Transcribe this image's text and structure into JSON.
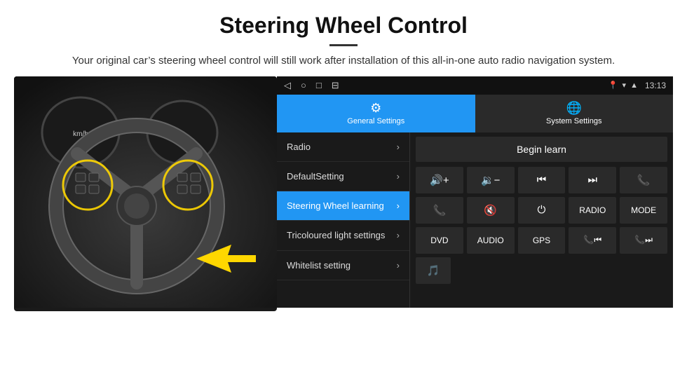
{
  "header": {
    "title": "Steering Wheel Control",
    "divider": true,
    "subtitle": "Your original car’s steering wheel control will still work after installation of this all-in-one auto radio navigation system."
  },
  "status_bar": {
    "time": "13:13",
    "icons_left": [
      "back",
      "home",
      "square",
      "menu"
    ],
    "icons_right": [
      "location",
      "wifi",
      "signal"
    ]
  },
  "tabs": [
    {
      "id": "general",
      "label": "General Settings",
      "active": true
    },
    {
      "id": "system",
      "label": "System Settings",
      "active": false
    }
  ],
  "settings_items": [
    {
      "id": "radio",
      "label": "Radio",
      "active": false
    },
    {
      "id": "default",
      "label": "DefaultSetting",
      "active": false
    },
    {
      "id": "steering",
      "label": "Steering Wheel learning",
      "active": true
    },
    {
      "id": "tricoloured",
      "label": "Tricoloured light settings",
      "active": false,
      "multiline": true
    },
    {
      "id": "whitelist",
      "label": "Whitelist setting",
      "active": false
    }
  ],
  "controls": {
    "begin_learn_label": "Begin learn",
    "row1": [
      {
        "id": "vol-up",
        "symbol": "🔊+"
      },
      {
        "id": "vol-down",
        "symbol": "🔉−"
      },
      {
        "id": "prev-track",
        "symbol": "⏮"
      },
      {
        "id": "next-track",
        "symbol": "⏭"
      },
      {
        "id": "phone",
        "symbol": "📞"
      }
    ],
    "row2": [
      {
        "id": "call-answer",
        "symbol": "📞"
      },
      {
        "id": "mute",
        "symbol": "🔇"
      },
      {
        "id": "power",
        "symbol": "⏻"
      },
      {
        "id": "radio-btn",
        "symbol": "RADIO"
      },
      {
        "id": "mode-btn",
        "symbol": "MODE"
      }
    ],
    "row3": [
      {
        "id": "dvd-btn",
        "symbol": "DVD"
      },
      {
        "id": "audio-btn",
        "symbol": "AUDIO"
      },
      {
        "id": "gps-btn",
        "symbol": "GPS"
      },
      {
        "id": "tel-prev",
        "symbol": "📞⏮"
      },
      {
        "id": "tel-next",
        "symbol": "📞⏭"
      }
    ],
    "row4": [
      {
        "id": "media-icon",
        "symbol": "🎵"
      }
    ]
  }
}
